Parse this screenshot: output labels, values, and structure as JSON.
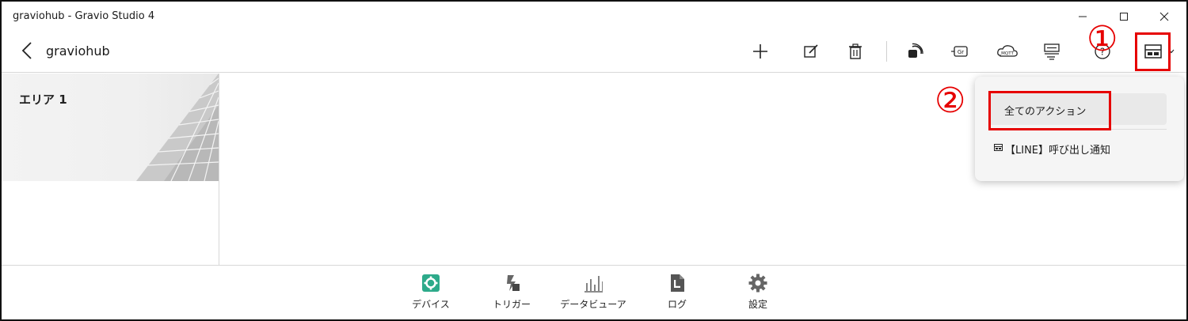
{
  "window": {
    "title": "graviohub - Gravio Studio 4",
    "controls": [
      "minimize-icon",
      "maximize-icon",
      "close-icon"
    ]
  },
  "toolbar": {
    "hub_name": "graviohub",
    "buttons": [
      "add-icon",
      "edit-icon",
      "delete-icon",
      "nfc-icon",
      "gr-icon",
      "mqtt-icon",
      "list-icon",
      "help-icon",
      "actions-icon"
    ],
    "gr_label": "Gr",
    "mqtt_label": "MQTT",
    "help_label": "?"
  },
  "area": {
    "label": "エリア 1"
  },
  "dropdown": {
    "items": [
      {
        "label": "全てのアクション"
      },
      {
        "label": "【LINE】呼び出し通知",
        "icon": "action-icon"
      }
    ]
  },
  "bottom_nav": {
    "items": [
      {
        "label": "デバイス",
        "icon": "gear-icon",
        "accent": "#2daa8a"
      },
      {
        "label": "トリガー",
        "icon": "trigger-icon"
      },
      {
        "label": "データビューア",
        "icon": "chart-icon"
      },
      {
        "label": "ログ",
        "icon": "log-icon"
      },
      {
        "label": "設定",
        "icon": "gear-icon"
      }
    ]
  },
  "annotations": {
    "one": "①",
    "two": "②",
    "color": "#e60000"
  }
}
